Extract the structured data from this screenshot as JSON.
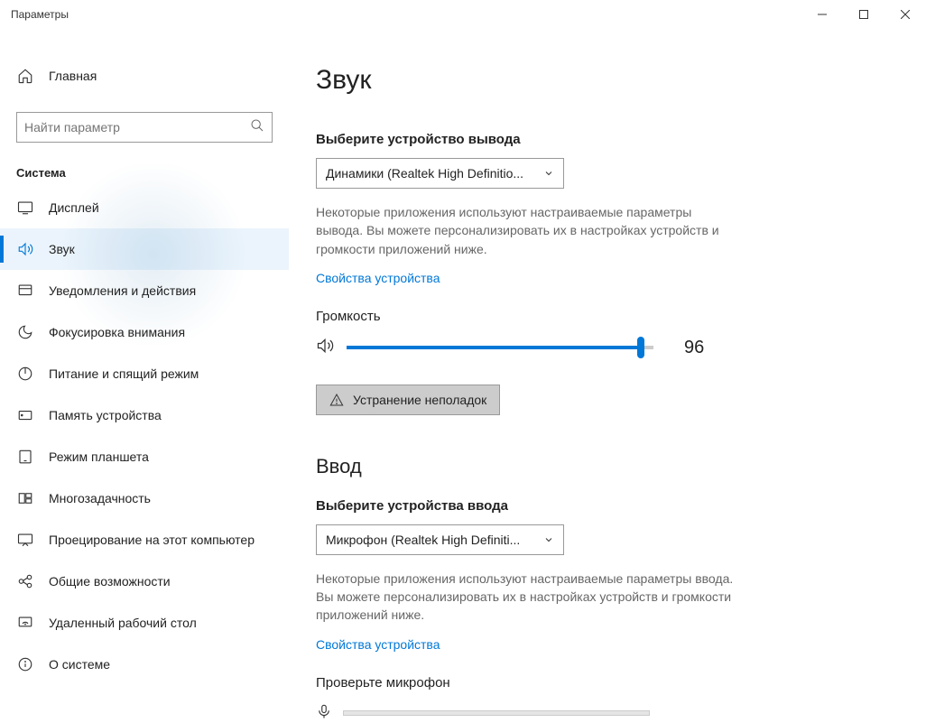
{
  "window": {
    "title": "Параметры"
  },
  "sidebar": {
    "home": "Главная",
    "search_placeholder": "Найти параметр",
    "section": "Система",
    "items": [
      {
        "label": "Дисплей"
      },
      {
        "label": "Звук"
      },
      {
        "label": "Уведомления и действия"
      },
      {
        "label": "Фокусировка внимания"
      },
      {
        "label": "Питание и спящий режим"
      },
      {
        "label": "Память устройства"
      },
      {
        "label": "Режим планшета"
      },
      {
        "label": "Многозадачность"
      },
      {
        "label": "Проецирование на этот компьютер"
      },
      {
        "label": "Общие возможности"
      },
      {
        "label": "Удаленный рабочий стол"
      },
      {
        "label": "О системе"
      }
    ]
  },
  "main": {
    "title": "Звук",
    "output": {
      "select_label": "Выберите устройство вывода",
      "device": "Динамики (Realtek High Definitio...",
      "help": "Некоторые приложения используют настраиваемые параметры вывода. Вы можете персонализировать их в настройках устройств и громкости приложений ниже.",
      "props_link": "Свойства устройства",
      "volume_label": "Громкость",
      "volume_value": "96",
      "volume_percent": 96,
      "troubleshoot": "Устранение неполадок"
    },
    "input": {
      "heading": "Ввод",
      "select_label": "Выберите устройства ввода",
      "device": "Микрофон (Realtek High Definiti...",
      "help": "Некоторые приложения используют настраиваемые параметры ввода. Вы можете персонализировать их в настройках устройств и громкости приложений ниже.",
      "props_link": "Свойства устройства",
      "test_label": "Проверьте микрофон"
    }
  }
}
